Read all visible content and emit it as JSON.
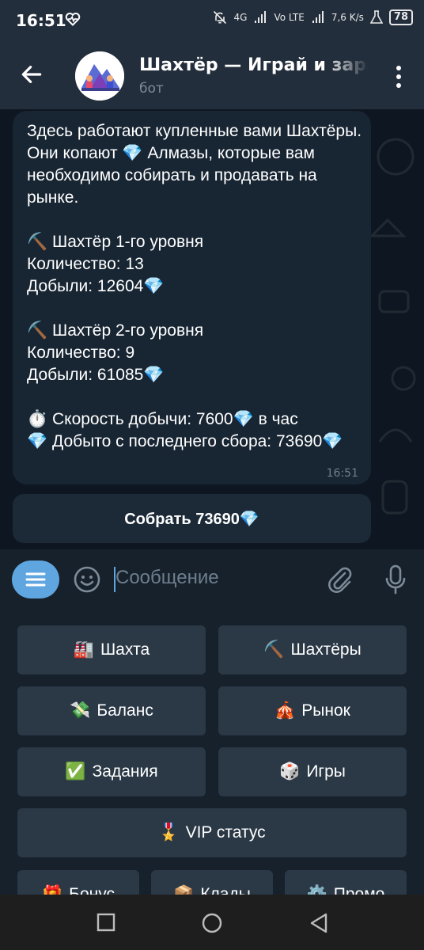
{
  "status_bar": {
    "time": "16:51",
    "network": "4G",
    "volte": "Vo LTE",
    "speed": "7,6 K/s",
    "battery": "78"
  },
  "header": {
    "title": "Шахтёр — Играй и зарабатывай",
    "subtitle": "бот"
  },
  "message": {
    "text": "Здесь работают купленные вами Шахтёры. Они копают 💎 Алмазы, которые вам необходимо собирать и продавать на рынке.\n\n⛏️ Шахтёр 1-го уровня\nКоличество: 13\nДобыли: 12604💎\n\n⛏️ Шахтёр 2-го уровня\nКоличество: 9\nДобыли: 61085💎\n\n⏱️ Скорость добычи: 7600💎 в час\n💎 Добыто с последнего сбора: 73690💎",
    "time": "16:51"
  },
  "inline_button": {
    "label": "Собрать 73690💎"
  },
  "input": {
    "placeholder": "Сообщение"
  },
  "keyboard": {
    "mine": {
      "emoji": "🏭",
      "label": "Шахта"
    },
    "miners": {
      "emoji": "⛏️",
      "label": "Шахтёры"
    },
    "balance": {
      "emoji": "💸",
      "label": "Баланс"
    },
    "market": {
      "emoji": "🎪",
      "label": "Рынок"
    },
    "tasks": {
      "emoji": "✅",
      "label": "Задания"
    },
    "games": {
      "emoji": "🎲",
      "label": "Игры"
    },
    "vip": {
      "emoji": "🎖️",
      "label": "VIP статус"
    },
    "bonus": {
      "emoji": "🎁",
      "label": "Бонус"
    },
    "treasures": {
      "emoji": "📦",
      "label": "Клады"
    },
    "promo": {
      "emoji": "⚙️",
      "label": "Промо"
    }
  }
}
